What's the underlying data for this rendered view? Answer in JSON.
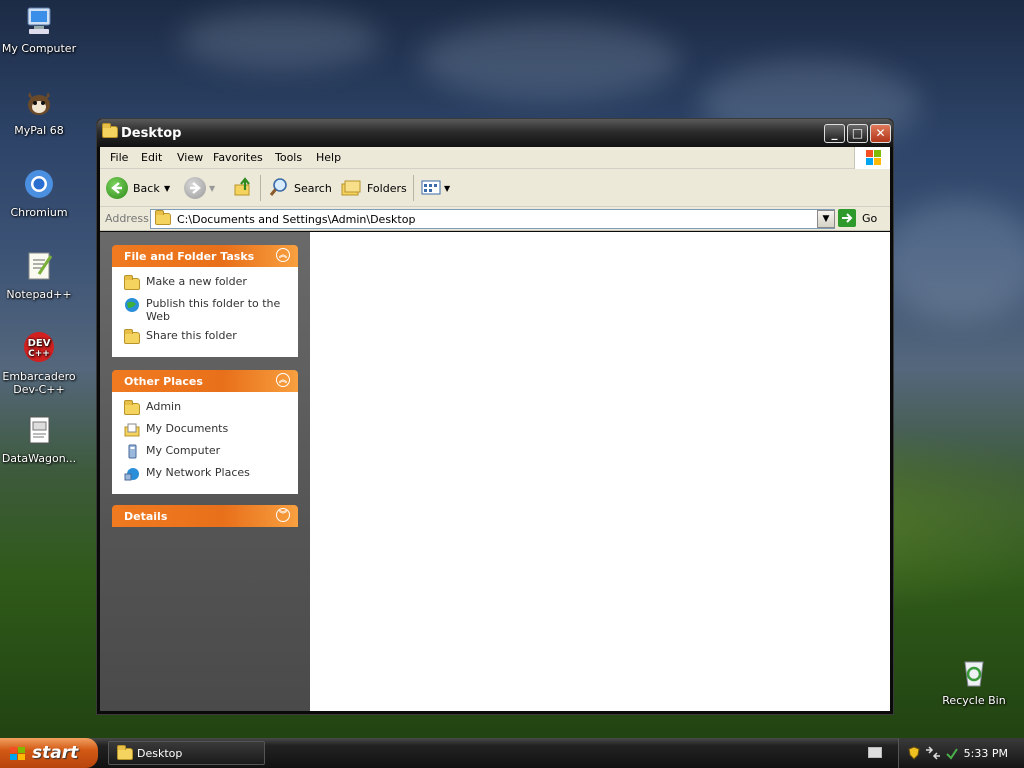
{
  "desktop": {
    "icons": [
      {
        "label": "My Computer",
        "icon": "computer-icon"
      },
      {
        "label": "MyPal 68",
        "icon": "mypal-icon"
      },
      {
        "label": "Chromium",
        "icon": "chromium-icon"
      },
      {
        "label": "Notepad++",
        "icon": "notepadpp-icon"
      },
      {
        "label": "Embarcadero Dev-C++",
        "icon": "devcpp-icon"
      },
      {
        "label": "DataWagon...",
        "icon": "document-icon"
      },
      {
        "label": "Recycle Bin",
        "icon": "recycle-bin-icon"
      }
    ],
    "icon_devcpp_text": "DEV\nC++"
  },
  "window": {
    "title": "Desktop",
    "menu": [
      "File",
      "Edit",
      "View",
      "Favorites",
      "Tools",
      "Help"
    ],
    "toolbar": {
      "back_label": "Back",
      "search_label": "Search",
      "folders_label": "Folders"
    },
    "address": {
      "label": "Address",
      "value": "C:\\Documents and Settings\\Admin\\Desktop",
      "go_label": "Go"
    },
    "taskpane": {
      "panels": [
        {
          "title": "File and Folder Tasks",
          "items": [
            "Make a new folder",
            "Publish this folder to the Web",
            "Share this folder"
          ]
        },
        {
          "title": "Other Places",
          "items": [
            "Admin",
            "My Documents",
            "My Computer",
            "My Network Places"
          ]
        },
        {
          "title": "Details",
          "items": []
        }
      ]
    }
  },
  "taskbar": {
    "start_label": "start",
    "items": [
      {
        "label": "Desktop"
      }
    ],
    "clock": "5:33 PM"
  },
  "colors": {
    "taskpane_header": "#e8701a",
    "address_border": "#7f9db9",
    "start_button": "#d35a15"
  }
}
